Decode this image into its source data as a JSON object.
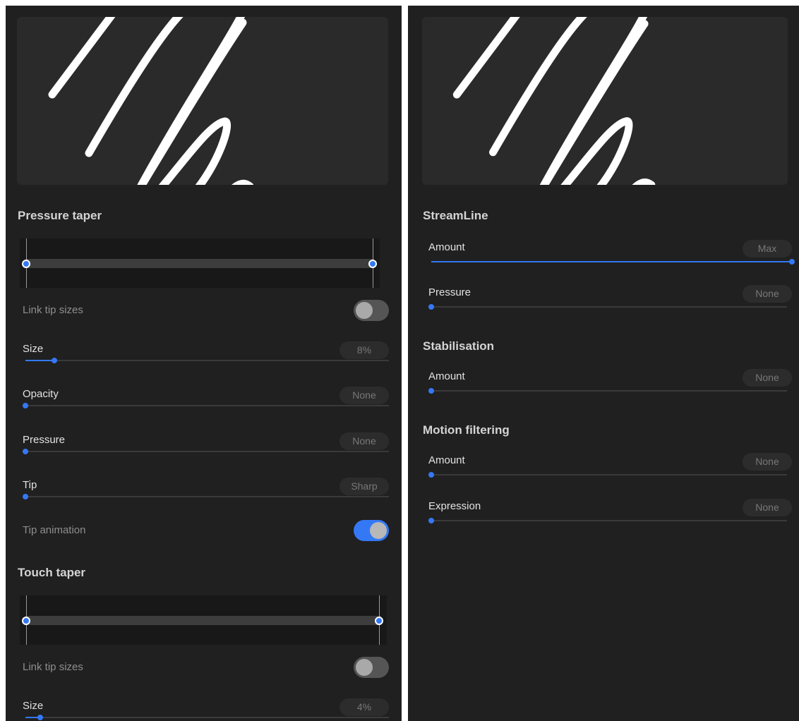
{
  "colors": {
    "accent": "#3478f6",
    "panel_bg": "#202020",
    "preview_bg": "#2a2a2a"
  },
  "left": {
    "pressure_taper": {
      "title": "Pressure taper",
      "link_tip_sizes": {
        "label": "Link tip sizes",
        "on": false
      },
      "size": {
        "label": "Size",
        "value": "8%",
        "fraction": 0.08
      },
      "opacity": {
        "label": "Opacity",
        "value": "None",
        "fraction": 0.0
      },
      "pressure": {
        "label": "Pressure",
        "value": "None",
        "fraction": 0.0
      },
      "tip": {
        "label": "Tip",
        "value": "Sharp",
        "fraction": 0.0
      },
      "tip_animation": {
        "label": "Tip animation",
        "on": true
      }
    },
    "touch_taper": {
      "title": "Touch taper",
      "link_tip_sizes": {
        "label": "Link tip sizes",
        "on": false
      },
      "size": {
        "label": "Size",
        "value": "4%",
        "fraction": 0.04
      }
    }
  },
  "right": {
    "streamline": {
      "title": "StreamLine",
      "amount": {
        "label": "Amount",
        "value": "Max",
        "fraction": 1.0
      },
      "pressure": {
        "label": "Pressure",
        "value": "None",
        "fraction": 0.0
      }
    },
    "stabilisation": {
      "title": "Stabilisation",
      "amount": {
        "label": "Amount",
        "value": "None",
        "fraction": 0.0
      }
    },
    "motion_filtering": {
      "title": "Motion filtering",
      "amount": {
        "label": "Amount",
        "value": "None",
        "fraction": 0.0
      },
      "expression": {
        "label": "Expression",
        "value": "None",
        "fraction": 0.0
      }
    }
  }
}
